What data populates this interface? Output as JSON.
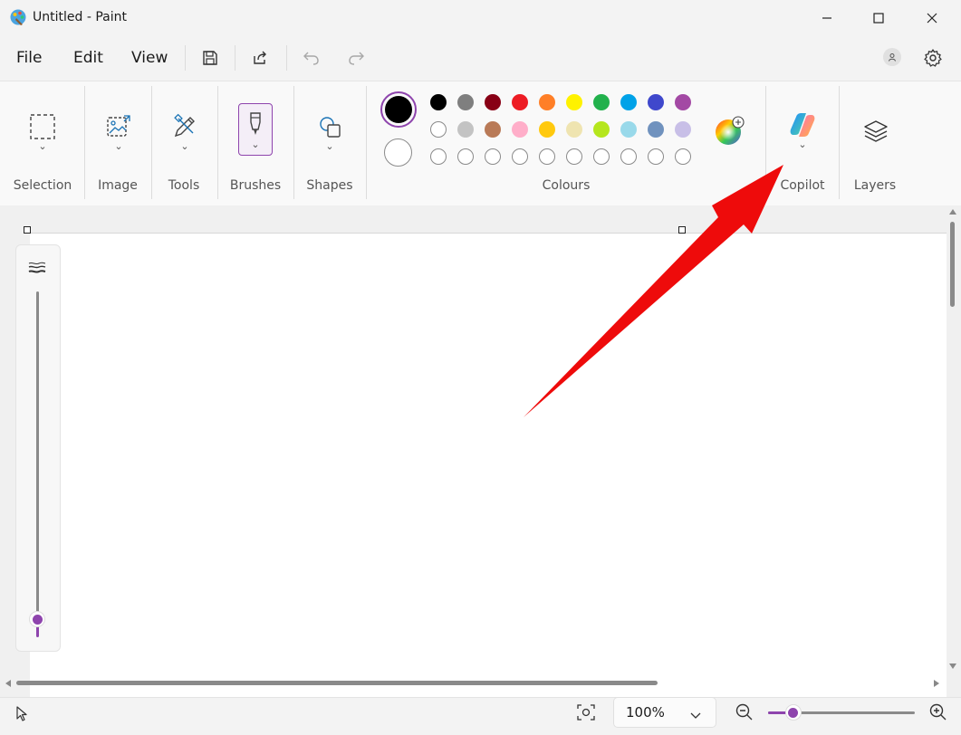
{
  "window": {
    "title": "Untitled - Paint"
  },
  "menu": {
    "items": [
      "File",
      "Edit",
      "View"
    ]
  },
  "ribbon": {
    "groups": {
      "selection": "Selection",
      "image": "Image",
      "tools": "Tools",
      "brushes": "Brushes",
      "shapes": "Shapes",
      "colours": "Colours",
      "copilot": "Copilot",
      "layers": "Layers"
    },
    "palette_row1": [
      "#000000",
      "#7f7f7f",
      "#880015",
      "#ed1c24",
      "#ff7f27",
      "#fff200",
      "#22b14c",
      "#00a2e8",
      "#3f48cc",
      "#a349a4"
    ],
    "palette_row2": [
      "#ffffff",
      "#c3c3c3",
      "#b97a57",
      "#ffaec9",
      "#ffc90e",
      "#efe4b0",
      "#b5e61d",
      "#99d9ea",
      "#7092be",
      "#c8bfe7"
    ],
    "palette_row3_count": 10,
    "primary_colour": "#000000",
    "secondary_colour": "#ffffff"
  },
  "status": {
    "zoom": "100%",
    "zoom_slider_fraction": 0.17
  },
  "colors": {
    "accent": "#8e44ad",
    "annotation_arrow": "#ee0b0b"
  }
}
